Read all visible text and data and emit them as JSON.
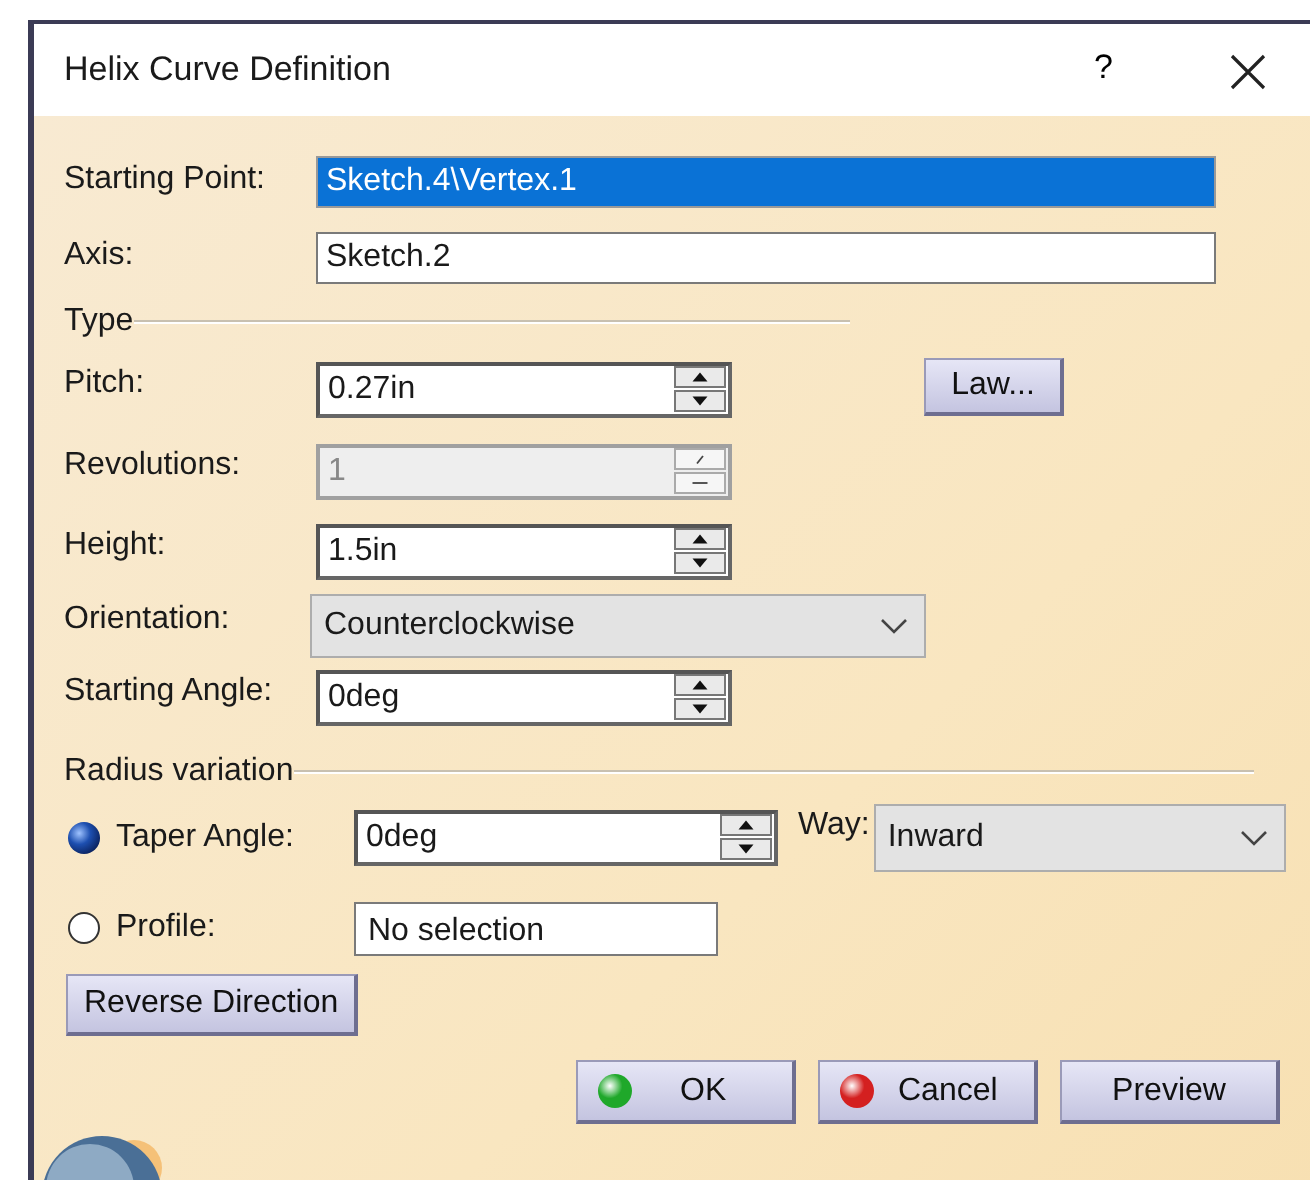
{
  "window": {
    "title": "Helix Curve Definition",
    "help": "?"
  },
  "inputs": [
    {
      "label": "Starting Point:",
      "value": "Sketch.4\\Vertex.1",
      "selected": true
    },
    {
      "label": "Axis:",
      "value": "Sketch.2",
      "selected": false
    }
  ],
  "type_section": {
    "title": "Type",
    "law_button": "Law...",
    "rows": [
      {
        "kind": "spinner",
        "label": "Pitch:",
        "value": "0.27in",
        "disabled": false
      },
      {
        "kind": "spinner",
        "label": "Revolutions:",
        "value": "1",
        "disabled": true
      },
      {
        "kind": "spinner",
        "label": "Height:",
        "value": "1.5in",
        "disabled": false
      },
      {
        "kind": "dropdown",
        "label": "Orientation:",
        "value": "Counterclockwise"
      },
      {
        "kind": "spinner",
        "label": "Starting Angle:",
        "value": "0deg",
        "disabled": false
      }
    ]
  },
  "radius_section": {
    "title": "Radius variation",
    "options": [
      {
        "kind": "spinner",
        "label": "Taper Angle:",
        "value": "0deg",
        "selected": true
      },
      {
        "kind": "text",
        "label": "Profile:",
        "value": "No selection",
        "selected": false
      }
    ],
    "way": {
      "label": "Way:",
      "value": "Inward"
    }
  },
  "reverse_button": "Reverse Direction",
  "buttons": [
    {
      "kind": "ok",
      "label": "OK"
    },
    {
      "kind": "cancel",
      "label": "Cancel"
    },
    {
      "kind": "plain",
      "label": "Preview"
    }
  ]
}
